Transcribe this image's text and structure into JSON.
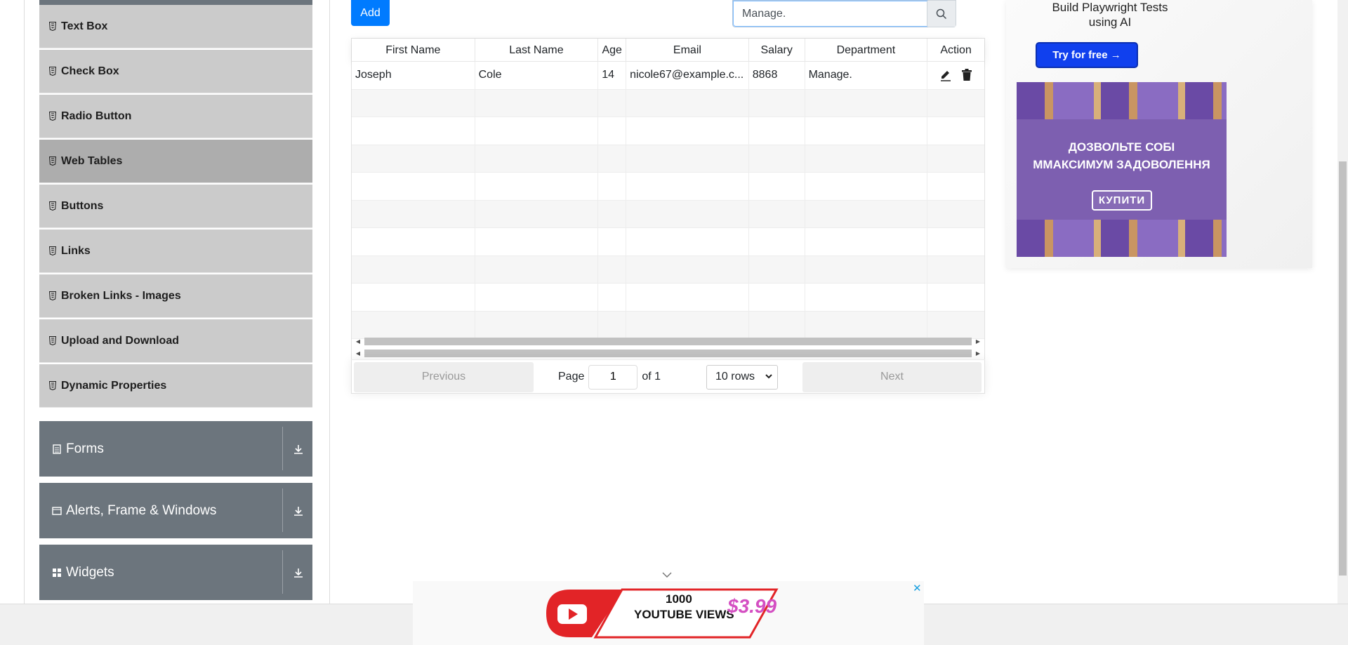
{
  "sidebar": {
    "items": [
      {
        "label": "Text Box",
        "active": false
      },
      {
        "label": "Check Box",
        "active": false
      },
      {
        "label": "Radio Button",
        "active": false
      },
      {
        "label": "Web Tables",
        "active": true
      },
      {
        "label": "Buttons",
        "active": false
      },
      {
        "label": "Links",
        "active": false
      },
      {
        "label": "Broken Links - Images",
        "active": false
      },
      {
        "label": "Upload and Download",
        "active": false
      },
      {
        "label": "Dynamic Properties",
        "active": false
      }
    ],
    "groups": [
      {
        "label": "Forms",
        "icon": "document-icon"
      },
      {
        "label": "Alerts, Frame & Windows",
        "icon": "window-icon"
      },
      {
        "label": "Widgets",
        "icon": "grid-icon"
      }
    ]
  },
  "toolbar": {
    "add_label": "Add",
    "search_value": "Manage.",
    "search_icon": "search-icon"
  },
  "table": {
    "headers": [
      "First Name",
      "Last Name",
      "Age",
      "Email",
      "Salary",
      "Department",
      "Action"
    ],
    "rows": [
      {
        "first": "Joseph",
        "last": "Cole",
        "age": "14",
        "email": "nicole67@example.c...",
        "salary": "8868",
        "department": "Manage."
      }
    ],
    "empty_rows": 9
  },
  "pagination": {
    "previous_label": "Previous",
    "page_label": "Page",
    "page_value": "1",
    "of_label": "of 1",
    "rows_label": "10 rows",
    "next_label": "Next"
  },
  "ad": {
    "title": "Build Playwright Tests using AI",
    "button": "Try for free →",
    "milka_line1": "ДОЗВОЛЬТЕ СОБІ",
    "milka_line2": "ММАКСИМУМ ЗАДОВОЛЕННЯ",
    "milka_buy": "КУПИТИ"
  },
  "bottom_ad": {
    "line1": "1000",
    "line2": "YOUTUBE VIEWS",
    "price": "$3.99"
  },
  "colors": {
    "primary": "#007bff",
    "sidebar_group": "#6c757d",
    "sidebar_item": "#cbcbcb",
    "sidebar_active": "#adadad"
  }
}
